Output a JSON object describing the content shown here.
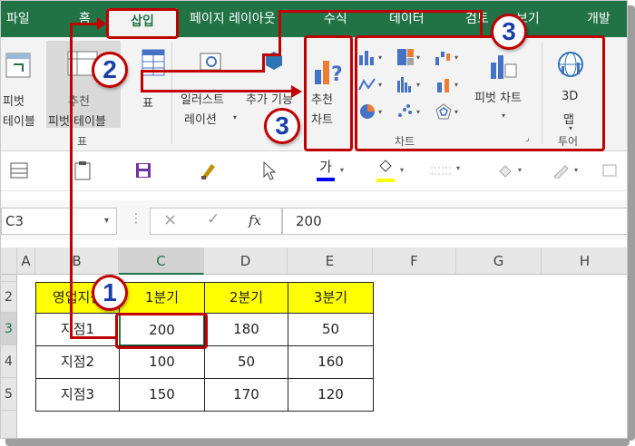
{
  "tabs": [
    "파일",
    "홈",
    "삽입",
    "페이지 레이아웃",
    "수식",
    "데이터",
    "검토",
    "보기",
    "개발"
  ],
  "ribbon": {
    "pivot_label": [
      "피벗",
      "테이블"
    ],
    "recommended_pivot_label": [
      "추천",
      "피벗 테이블"
    ],
    "table_label": "표",
    "table_group_label": "표",
    "illustration_label": [
      "일러스트",
      "레이션"
    ],
    "addin_label": "추가 기능",
    "recommended_chart_label": [
      "추천",
      "차트"
    ],
    "pivot_chart_label": "피벗 차트",
    "map3d_label": [
      "3D",
      "맵"
    ],
    "chart_group_label": "차트",
    "tour_group_label": "투어"
  },
  "namebox": "C3",
  "formula_value": "200",
  "columns": [
    "A",
    "B",
    "C",
    "D",
    "E",
    "F",
    "G",
    "H"
  ],
  "rows": [
    "2",
    "3",
    "4",
    "5"
  ],
  "table": {
    "header": [
      "영업지점",
      "1분기",
      "2분기",
      "3분기"
    ],
    "data": [
      [
        "지점1",
        "200",
        "180",
        "50"
      ],
      [
        "지점2",
        "100",
        "50",
        "160"
      ],
      [
        "지점3",
        "150",
        "170",
        "120"
      ]
    ]
  },
  "badges": [
    "1",
    "2",
    "3",
    "3"
  ],
  "colors": {
    "accent": "#217346",
    "annotation": "#c00000",
    "badge_text": "#1a3fa8",
    "header_fill": "#ffff00"
  }
}
